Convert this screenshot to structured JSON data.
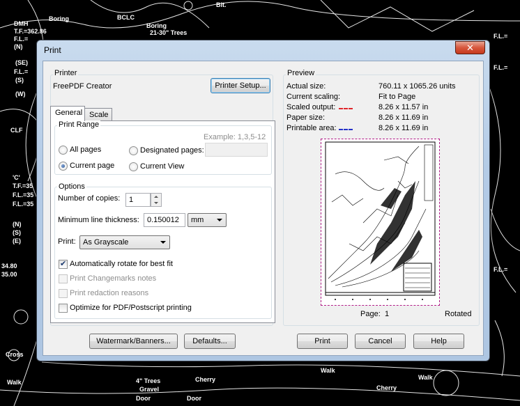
{
  "background_labels": [
    "DMH",
    "T.F.=362.86",
    "F.L.=",
    "(N)",
    "(SE)",
    "F.L.=",
    "(S)",
    "(W)",
    "Boring",
    "BCLC",
    "Boring",
    "21-30\" Trees",
    "Bit.",
    "F.L.=",
    "F.L.=",
    "CLF",
    "'C'",
    "T.F.=35",
    "F.L.=35",
    "F.L.=35",
    "(N)",
    "(S)",
    "(E)",
    "4\" Trees",
    "Gravel",
    "Door",
    "Door",
    "Walk",
    "Walk",
    "Cherry",
    "Cherry",
    "Walk",
    "Cross",
    "34.80",
    "35.00",
    "F.L.="
  ],
  "window": {
    "title": "Print",
    "close_glyph": "✕"
  },
  "printer": {
    "group_label": "Printer",
    "name": "FreePDF Creator",
    "setup_button": "Printer Setup..."
  },
  "tabs": [
    {
      "label": "General"
    },
    {
      "label": "Scale"
    }
  ],
  "print_range": {
    "group_label": "Print Range",
    "example_hint": "Example: 1,3,5-12",
    "all_pages": "All pages",
    "current_page": "Current page",
    "designated_pages": "Designated pages:",
    "current_view": "Current View",
    "designated_value": "",
    "selected": "current_page"
  },
  "options": {
    "group_label": "Options",
    "copies_label": "Number of copies:",
    "copies_value": "1",
    "line_thickness_label": "Minimum line thickness:",
    "line_thickness_value": "0.150012",
    "line_unit": "mm",
    "print_label": "Print:",
    "print_mode": "As Grayscale",
    "auto_rotate": {
      "label": "Automatically rotate for best fit",
      "checked": true,
      "enabled": true
    },
    "changemarks": {
      "label": "Print Changemarks notes",
      "checked": false,
      "enabled": false
    },
    "redaction": {
      "label": "Print redaction reasons",
      "checked": false,
      "enabled": false
    },
    "optimize": {
      "label": "Optimize for PDF/Postscript printing",
      "checked": false,
      "enabled": true
    }
  },
  "preview": {
    "group_label": "Preview",
    "rows": [
      {
        "label": "Actual size:",
        "value": "760.11 x 1065.26 units"
      },
      {
        "label": "Current scaling:",
        "value": "Fit to Page"
      },
      {
        "label": "Scaled output:",
        "value": "8.26 x 11.57 in",
        "swatch": "#e0252b"
      },
      {
        "label": "Paper size:",
        "value": "8.26 x 11.69 in"
      },
      {
        "label": "Printable area:",
        "value": "8.26 x 11.69 in",
        "swatch": "#2532c8"
      }
    ],
    "page_label": "Page:",
    "page_number": "1",
    "rotated_label": "Rotated"
  },
  "buttons": {
    "watermark": "Watermark/Banners...",
    "defaults": "Defaults...",
    "print": "Print",
    "cancel": "Cancel",
    "help": "Help"
  }
}
